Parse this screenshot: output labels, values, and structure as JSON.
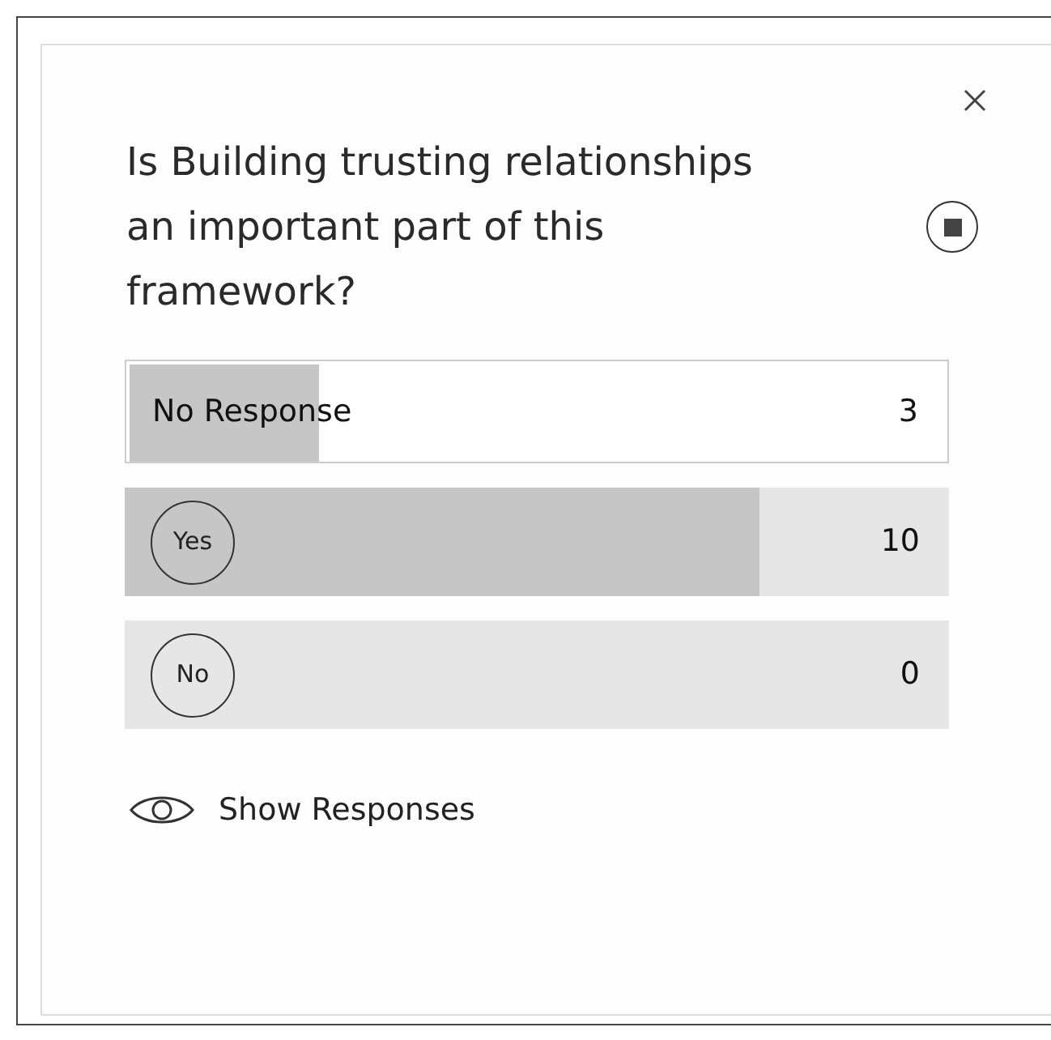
{
  "poll": {
    "question": "Is Building trusting relationships an important part of this framework?",
    "options": [
      {
        "kind": "plain",
        "label": "No Response",
        "count": "3",
        "level": 0.23
      },
      {
        "kind": "choice",
        "label": "Yes",
        "count": "10",
        "level": 0.77
      },
      {
        "kind": "choice",
        "label": "No",
        "count": "0",
        "level": 0
      }
    ],
    "show_responses": "Show Responses"
  }
}
